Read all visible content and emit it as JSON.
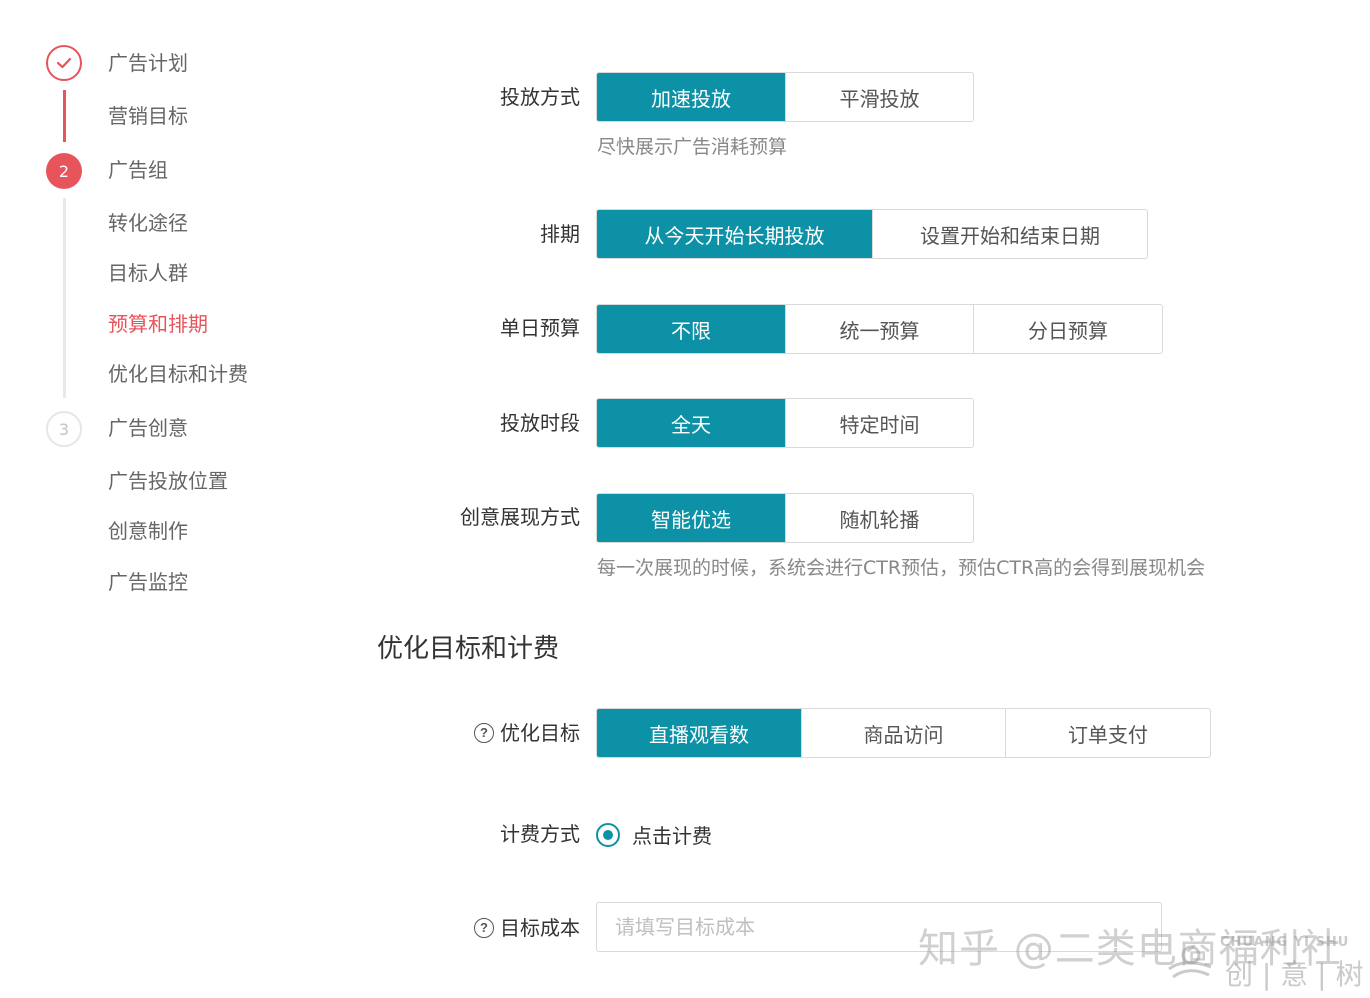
{
  "sidebar": {
    "step1_mark": "✓",
    "step2_number": "2",
    "step3_number": "3",
    "items": [
      {
        "label": "广告计划"
      },
      {
        "label": "营销目标"
      },
      {
        "label": "广告组"
      },
      {
        "label": "转化途径"
      },
      {
        "label": "目标人群"
      },
      {
        "label": "预算和排期",
        "active": true
      },
      {
        "label": "优化目标和计费"
      },
      {
        "label": "广告创意"
      },
      {
        "label": "广告投放位置"
      },
      {
        "label": "创意制作"
      },
      {
        "label": "广告监控"
      }
    ]
  },
  "form": {
    "delivery_method": {
      "label": "投放方式",
      "options": [
        "加速投放",
        "平滑投放"
      ],
      "selected": "加速投放",
      "hint": "尽快展示广告消耗预算"
    },
    "schedule": {
      "label": "排期",
      "options": [
        "从今天开始长期投放",
        "设置开始和结束日期"
      ],
      "selected": "从今天开始长期投放"
    },
    "daily_budget": {
      "label": "单日预算",
      "options": [
        "不限",
        "统一预算",
        "分日预算"
      ],
      "selected": "不限"
    },
    "time_slot": {
      "label": "投放时段",
      "options": [
        "全天",
        "特定时间"
      ],
      "selected": "全天"
    },
    "creative_display": {
      "label": "创意展现方式",
      "options": [
        "智能优选",
        "随机轮播"
      ],
      "selected": "智能优选",
      "hint": "每一次展现的时候，系统会进行CTR预估，预估CTR高的会得到展现机会"
    }
  },
  "section": {
    "title": "优化目标和计费"
  },
  "optimization": {
    "goal": {
      "label": "优化目标",
      "options": [
        "直播观看数",
        "商品访问",
        "订单支付"
      ],
      "selected": "直播观看数"
    },
    "billing": {
      "label": "计费方式",
      "radio_label": "点击计费",
      "checked": true
    },
    "target_cost": {
      "label": "目标成本",
      "placeholder": "请填写目标成本",
      "value": ""
    }
  },
  "watermark": {
    "text": "知乎 @二类电商福利社",
    "logo_en": "CHUANG YI SHU",
    "logo_cn": "创 | 意 | 树"
  },
  "colors": {
    "accent": "#0c91a6",
    "active_step": "#e8545c"
  }
}
